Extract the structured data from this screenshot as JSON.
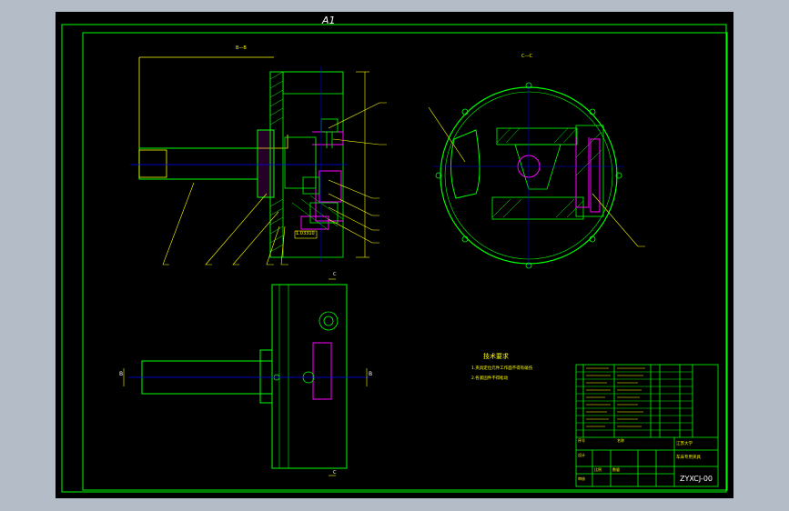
{
  "sheet": {
    "size_label": "A1",
    "colors": {
      "background": "#000000",
      "frame": "#00ff00",
      "centerline": "#0000ff",
      "section_fill": "#ff00ff",
      "annotation": "#ffff00",
      "text": "#ffffff",
      "outer_gray": "#b4bcc8"
    }
  },
  "views": {
    "section_top_left": "B—B",
    "section_top_right": "C—C",
    "cut_mark_b": "B",
    "cut_mark_c": "C",
    "dim_box": "1.03310"
  },
  "tech": {
    "title": "技术要求",
    "line1": "1.夹具定位元件工作面不得有碰伤",
    "line2": "2.各紧固件不得松动"
  },
  "title_block": {
    "drawing_number": "ZYXCJ-00",
    "drawing_name": "车床专用夹具",
    "school": "江苏大学",
    "scale_label": "比例",
    "qty_label": "数量",
    "designer_label": "设计",
    "checker_label": "审核",
    "seq_label": "序号",
    "name_label": "名称"
  }
}
